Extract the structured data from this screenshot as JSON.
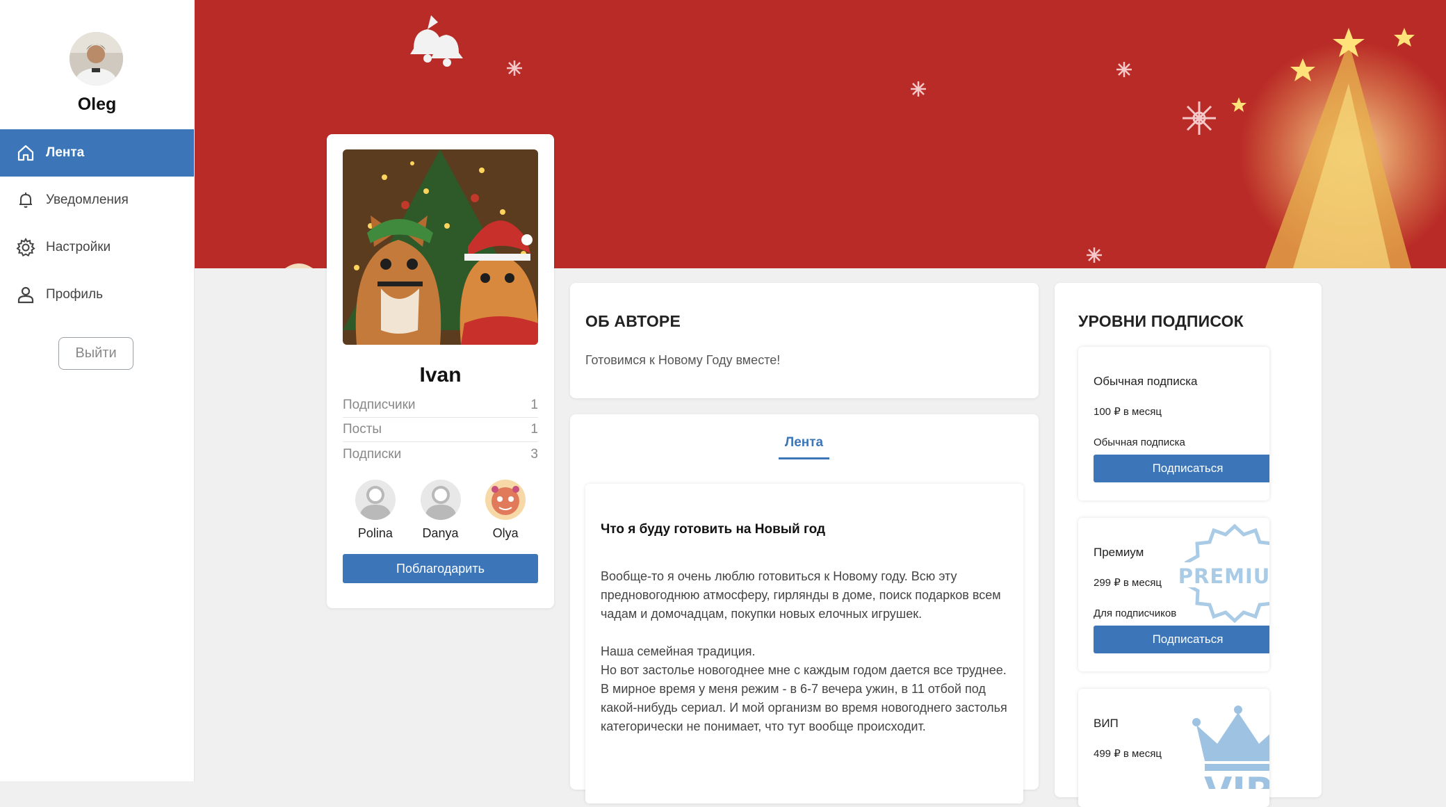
{
  "sidebar": {
    "user_name": "Oleg",
    "nav": [
      {
        "label": "Лента",
        "icon": "home-icon",
        "active": true
      },
      {
        "label": "Уведомления",
        "icon": "bell-icon",
        "active": false
      },
      {
        "label": "Настройки",
        "icon": "gear-icon",
        "active": false
      },
      {
        "label": "Профиль",
        "icon": "user-icon",
        "active": false
      }
    ],
    "logout_label": "Выйти"
  },
  "profile": {
    "name": "Ivan",
    "stats": [
      {
        "label": "Подписчики",
        "value": "1"
      },
      {
        "label": "Посты",
        "value": "1"
      },
      {
        "label": "Подписки",
        "value": "3"
      }
    ],
    "friends": [
      {
        "name": "Polina"
      },
      {
        "name": "Danya"
      },
      {
        "name": "Olya"
      }
    ],
    "thank_label": "Поблагодарить"
  },
  "about": {
    "title": "ОБ АВТОРЕ",
    "text": "Готовимся к Новому Году вместе!"
  },
  "feed": {
    "tab_label": "Лента",
    "post": {
      "title": "Что я буду готовить на Новый год",
      "paragraph_1": "Вообще-то я очень люблю готовиться к Новому году. Всю эту предновогоднюю атмосферу, гирлянды в доме, поиск подарков всем чадам и домочадцам, покупки новых елочных игрушек.",
      "paragraph_2": "Наша семейная традиция.",
      "paragraph_3": "Но вот застолье новогоднее мне с каждым годом дается все труднее. В мирное время у меня режим - в 6-7 вечера ужин, в 11 отбой под какой-нибудь сериал. И мой организм во время новогоднего застолья категорически не понимает, что тут вообще происходит."
    }
  },
  "tiers": {
    "title": "УРОВНИ ПОДПИСОК",
    "items": [
      {
        "name": "Обычная подписка",
        "price": "100 ₽ в месяц",
        "desc": "Обычная подписка",
        "button": "Подписаться"
      },
      {
        "name": "Премиум",
        "price": "299 ₽ в месяц",
        "desc": "Для подписчиков",
        "button": "Подписаться",
        "badge_text": "PREMIUM"
      },
      {
        "name": "ВИП",
        "price": "499 ₽ в месяц",
        "badge_text": "VIP"
      }
    ]
  },
  "colors": {
    "accent": "#3c76b9",
    "banner": "#b92b27",
    "background": "#f0f0f0"
  }
}
